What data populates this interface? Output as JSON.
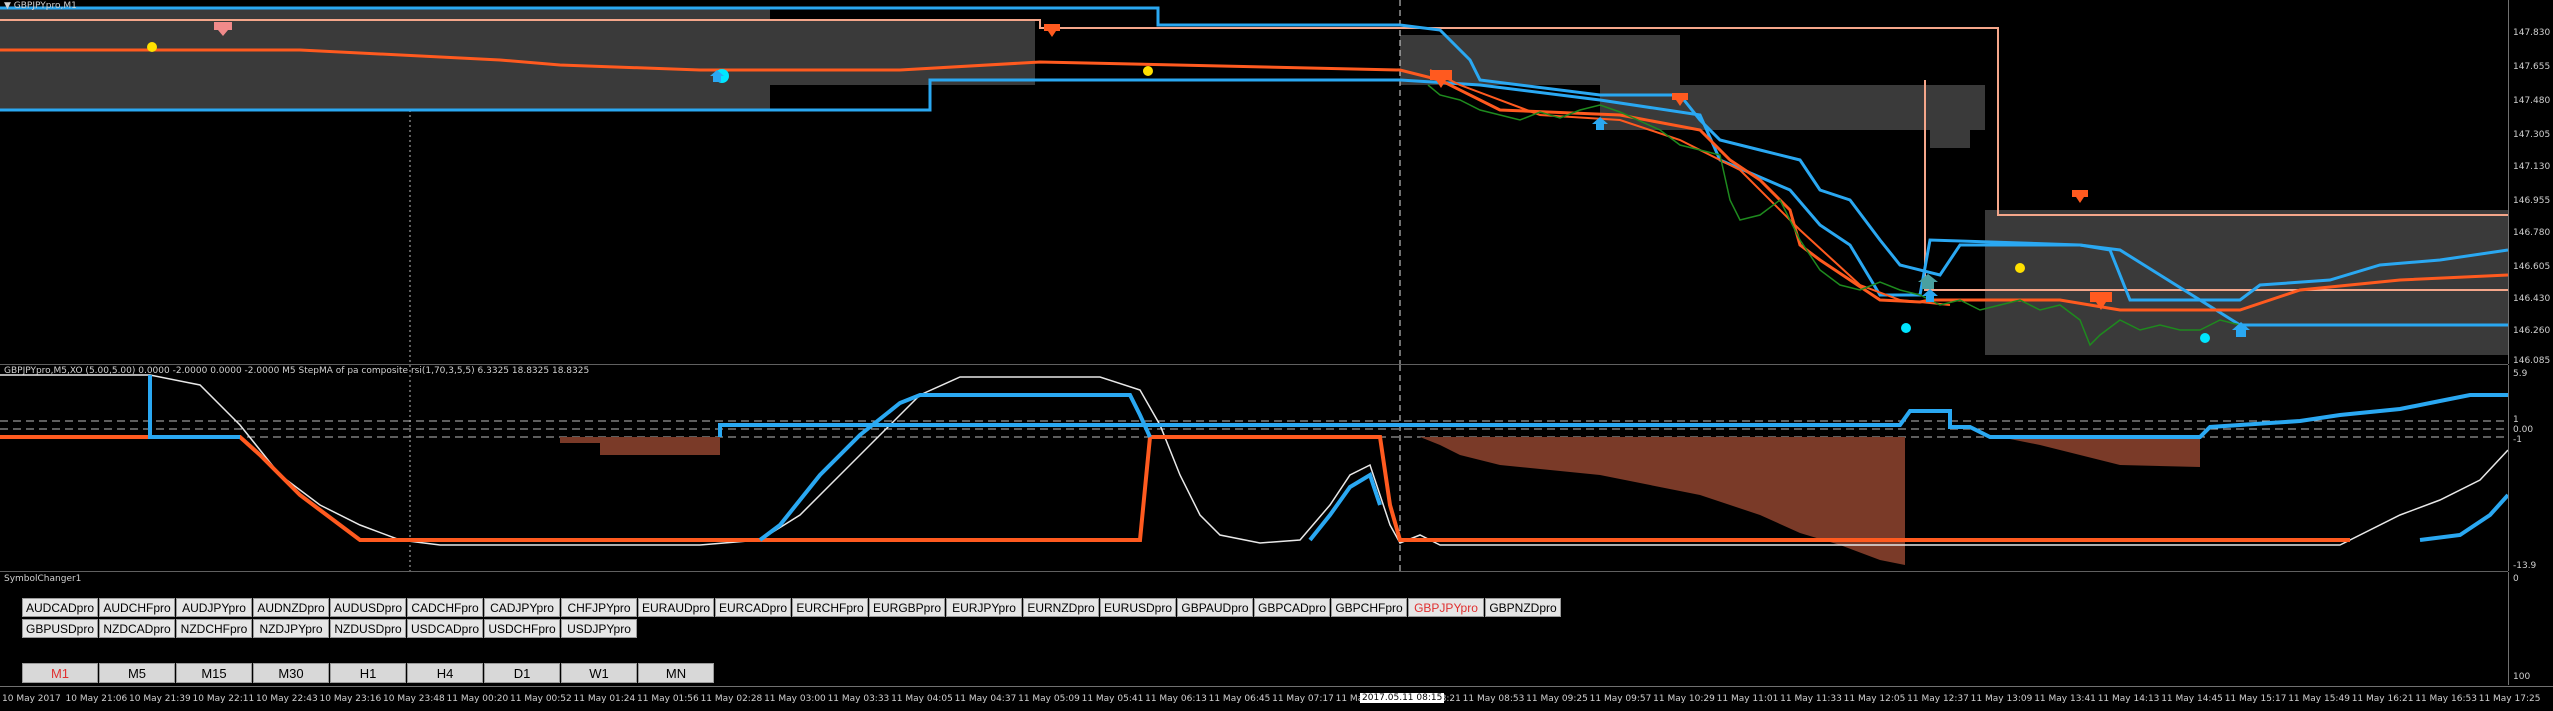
{
  "main_chart": {
    "title": "▼ GBPJPYpro,M1",
    "price_labels": [
      "147.830",
      "147.655",
      "147.480",
      "147.305",
      "147.130",
      "146.955",
      "146.780",
      "146.605",
      "146.430",
      "146.260",
      "146.085"
    ]
  },
  "indicator": {
    "title": "GBPJPYpro,M5,XO (5.00,5.00) 0.0000 -2.0000 0.0000 -2.0000  M5 StepMA of pa composite rsi(1,70,3,5,5) 6.3325 18.8325 18.8325",
    "scale_labels": [
      "5.9",
      "1",
      "0.00",
      "-1",
      "-13.9"
    ]
  },
  "symbol_changer": {
    "title": "SymbolChanger1",
    "scale_labels": [
      "0",
      "100"
    ],
    "row1": [
      "AUDCADpro",
      "AUDCHFpro",
      "AUDJPYpro",
      "AUDNZDpro",
      "AUDUSDpro",
      "CADCHFpro",
      "CADJPYpro",
      "CHFJPYpro",
      "EURAUDpro",
      "EURCADpro",
      "EURCHFpro",
      "EURGBPpro",
      "EURJPYpro",
      "EURNZDpro",
      "EURUSDpro",
      "GBPAUDpro",
      "GBPCADpro",
      "GBPCHFpro",
      "GBPJPYpro",
      "GBPNZDpro"
    ],
    "row2": [
      "GBPUSDpro",
      "NZDCADpro",
      "NZDCHFpro",
      "NZDJPYpro",
      "NZDUSDpro",
      "USDCADpro",
      "USDCHFpro",
      "USDJPYpro"
    ],
    "active_symbol": "GBPJPYpro",
    "timeframes": [
      "M1",
      "M5",
      "M15",
      "M30",
      "H1",
      "H4",
      "D1",
      "W1",
      "MN"
    ],
    "active_timeframe": "M1"
  },
  "time_axis": {
    "labels": [
      "10 May 2017",
      "10 May 21:06",
      "10 May 21:39",
      "10 May 22:11",
      "10 May 22:43",
      "10 May 23:16",
      "10 May 23:48",
      "11 May 00:20",
      "11 May 00:52",
      "11 May 01:24",
      "11 May 01:56",
      "11 May 02:28",
      "11 May 03:00",
      "11 May 03:33",
      "11 May 04:05",
      "11 May 04:37",
      "11 May 05:09",
      "11 May 05:41",
      "11 May 06:13",
      "11 May 06:45",
      "11 May 07:17",
      "11 May 07:49",
      "11 May 08:21",
      "11 May 08:53",
      "11 May 09:25",
      "11 May 09:57",
      "11 May 10:29",
      "11 May 11:01",
      "11 May 11:33",
      "11 May 12:05",
      "11 May 12:37",
      "11 May 13:09",
      "11 May 13:41",
      "11 May 14:13",
      "11 May 14:45",
      "11 May 15:17",
      "11 May 15:49",
      "11 May 16:21",
      "11 May 16:53",
      "11 May 17:25"
    ],
    "crosshair_time": "2017.05.11 08:15"
  },
  "colors": {
    "orange": "#ff5a1f",
    "blue": "#2aa8f2",
    "salmon": "#f5a68a",
    "green": "#1e8a1e",
    "zone": "#3a3a3a"
  }
}
